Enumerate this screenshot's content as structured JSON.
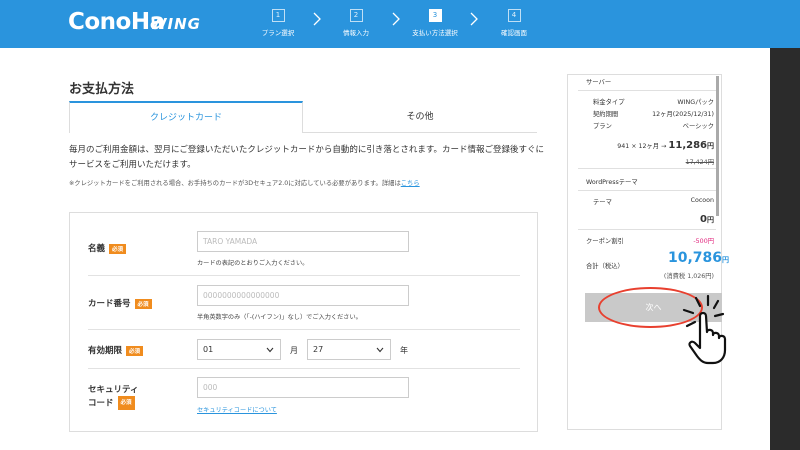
{
  "header": {
    "logo": "ConoHa",
    "logo_sub": "WING",
    "steps": [
      {
        "num": "1",
        "label": "プラン選択"
      },
      {
        "num": "2",
        "label": "情報入力"
      },
      {
        "num": "3",
        "label": "支払い方法選択"
      },
      {
        "num": "4",
        "label": "確認画面"
      }
    ],
    "active_step": 3
  },
  "page": {
    "title": "お支払方法",
    "tabs": [
      {
        "label": "クレジットカード",
        "active": true
      },
      {
        "label": "その他",
        "active": false
      }
    ],
    "description": "毎月のご利用金額は、翌月にご登録いただいたクレジットカードから自動的に引き落とされます。カード情報ご登録後すぐにサービスをご利用いただけます。",
    "note": "※クレジットカードをご利用される場合、お手持ちのカードが3Dセキュア2.0に対応している必要があります。詳細は",
    "note_link": "こちら"
  },
  "form": {
    "required_badge": "必須",
    "name": {
      "label": "名義",
      "placeholder": "TARO YAMADA",
      "hint": "カードの表記のとおりご入力ください。"
    },
    "card_number": {
      "label": "カード番号",
      "placeholder": "0000000000000000",
      "hint": "半角英数字のみ（「-(ハイフン)」なし）でご入力ください。"
    },
    "expiry": {
      "label": "有効期限",
      "month_value": "01",
      "month_unit": "月",
      "year_value": "27",
      "year_unit": "年"
    },
    "security": {
      "label_line1": "セキュリティ",
      "label_line2": "コード",
      "placeholder": "000",
      "link": "セキュリティコードについて"
    }
  },
  "summary": {
    "server_heading": "サーバー",
    "rows": [
      {
        "label": "料金タイプ",
        "value": "WINGパック"
      },
      {
        "label": "契約期間",
        "value": "12ヶ月(2025/12/31)"
      },
      {
        "label": "プラン",
        "value": "ベーシック"
      }
    ],
    "server_calc": "941 × 12ヶ月 →",
    "server_price": "11,286",
    "server_price_unit": "円",
    "server_original": "17,424円",
    "wp_heading": "WordPressテーマ",
    "theme_label": "テーマ",
    "theme_value": "Cocoon",
    "theme_price": "0",
    "theme_price_unit": "円",
    "coupon_label": "クーポン割引",
    "coupon_value": "-500円",
    "total_label": "合計（税込）",
    "total_value": "10,786",
    "total_unit": "円",
    "tax_note": "(消費税 1,026円)",
    "next_button": "次へ"
  },
  "colors": {
    "brand": "#2a94dd",
    "required": "#f08c1e",
    "highlight": "#e8402f",
    "coupon": "#e0207a"
  }
}
